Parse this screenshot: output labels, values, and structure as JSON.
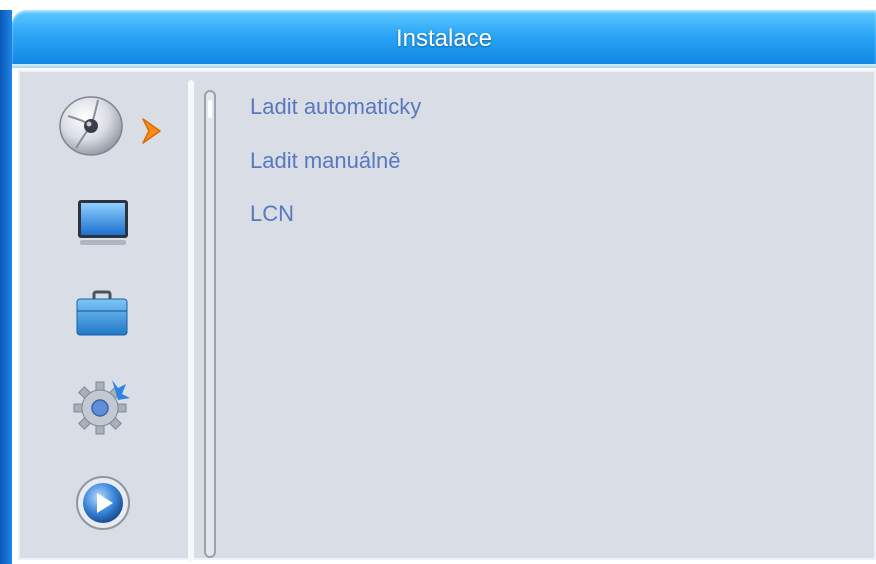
{
  "window": {
    "title": "Instalace"
  },
  "sidebar": {
    "icons": [
      {
        "name": "satellite-dish-icon",
        "active": true
      },
      {
        "name": "tv-icon",
        "active": false
      },
      {
        "name": "briefcase-icon",
        "active": false
      },
      {
        "name": "gear-icon",
        "active": false
      },
      {
        "name": "play-icon",
        "active": false
      }
    ]
  },
  "menu": {
    "items": [
      {
        "label": "Ladit automaticky"
      },
      {
        "label": "Ladit manuálně"
      },
      {
        "label": "LCN"
      }
    ]
  },
  "colors": {
    "title_bar": "#2aa6f5",
    "panel_bg": "#d8dde6",
    "menu_text": "#5a78bf",
    "selection_arrow": "#ff8c1a"
  }
}
